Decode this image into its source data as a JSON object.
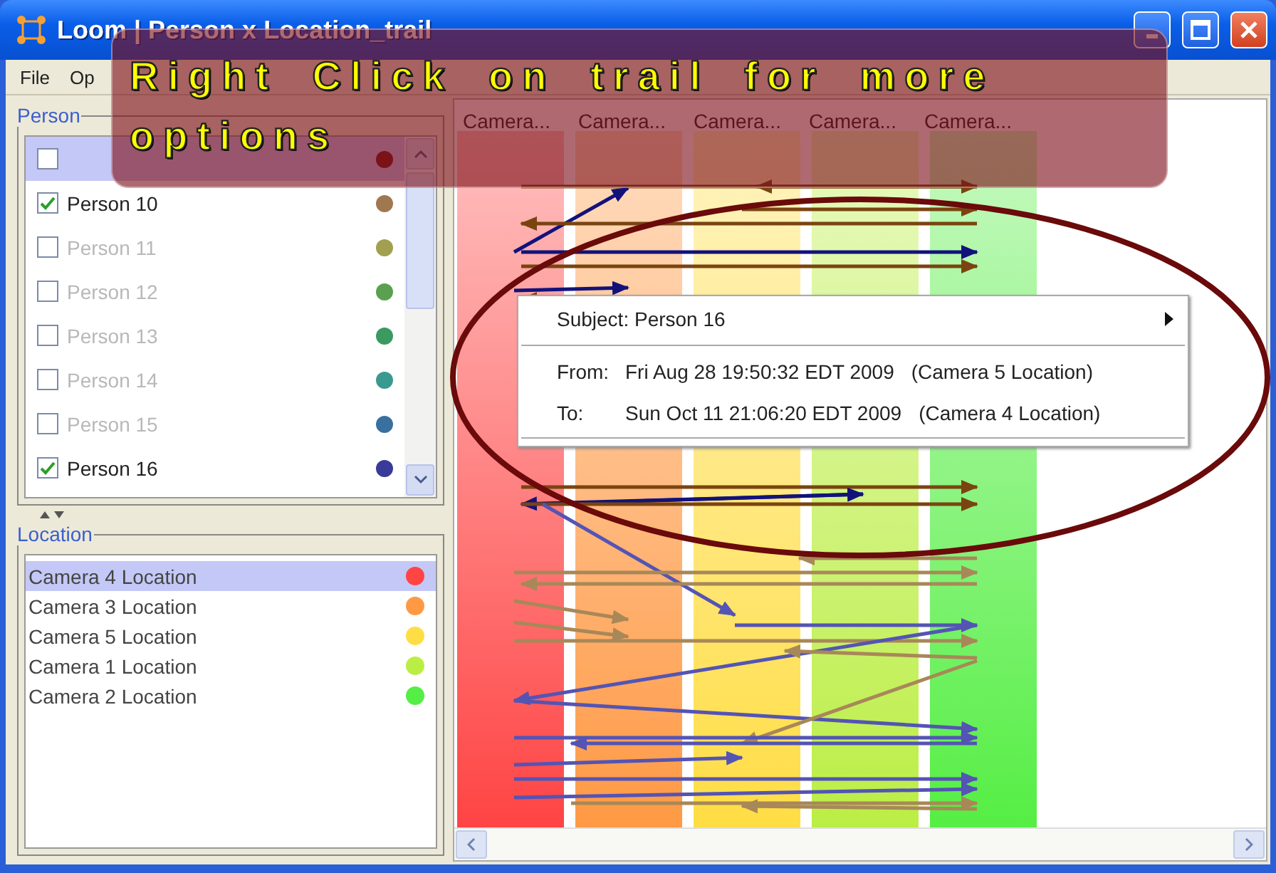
{
  "window": {
    "title": "Loom | Person x Location_trail"
  },
  "menu": [
    "File",
    "Op"
  ],
  "overlay_banner": {
    "lines": [
      "Right Click on trail for more",
      "options"
    ]
  },
  "person_panel": {
    "legend": "Person",
    "items": [
      {
        "checked": false,
        "selected": true,
        "color": "#7a1a1a"
      },
      {
        "label": "Person 10",
        "checked": true,
        "selected": false,
        "color": "#a07850"
      },
      {
        "label": "Person 11",
        "checked": false,
        "selected": false,
        "color": "#a0a050"
      },
      {
        "label": "Person 12",
        "checked": false,
        "selected": false,
        "color": "#5aa050"
      },
      {
        "label": "Person 13",
        "checked": false,
        "selected": false,
        "color": "#3a9a60"
      },
      {
        "label": "Person 14",
        "checked": false,
        "selected": false,
        "color": "#3a9a90"
      },
      {
        "label": "Person 15",
        "checked": false,
        "selected": false,
        "color": "#3a70a0"
      },
      {
        "label": "Person 16",
        "checked": true,
        "selected": false,
        "color": "#3a3a9a"
      }
    ]
  },
  "location_panel": {
    "legend": "Location",
    "items": [
      {
        "label": "Camera 4 Location",
        "selected": true,
        "color": "#ff4444"
      },
      {
        "label": "Camera 3 Location",
        "selected": false,
        "color": "#ff9944"
      },
      {
        "label": "Camera 5 Location",
        "selected": false,
        "color": "#ffdd44"
      },
      {
        "label": "Camera 1 Location",
        "selected": false,
        "color": "#bbee44"
      },
      {
        "label": "Camera 2 Location",
        "selected": false,
        "color": "#55ee44"
      }
    ]
  },
  "trail_view": {
    "column_headers": [
      "Camera...",
      "Camera...",
      "Camera...",
      "Camera...",
      "Camera..."
    ]
  },
  "context_menu": {
    "items": [
      {
        "kind": "submenu",
        "label": "Subject: Person 16"
      },
      {
        "kind": "separator"
      },
      {
        "kind": "detail",
        "label": "From:",
        "date": "Fri Aug 28 19:50:32 EDT 2009",
        "location": "(Camera 5 Location)"
      },
      {
        "kind": "detail",
        "label": "To:",
        "date": "Sun Oct 11 21:06:20 EDT 2009",
        "location": "(Camera 4 Location)"
      },
      {
        "kind": "separator"
      }
    ]
  }
}
